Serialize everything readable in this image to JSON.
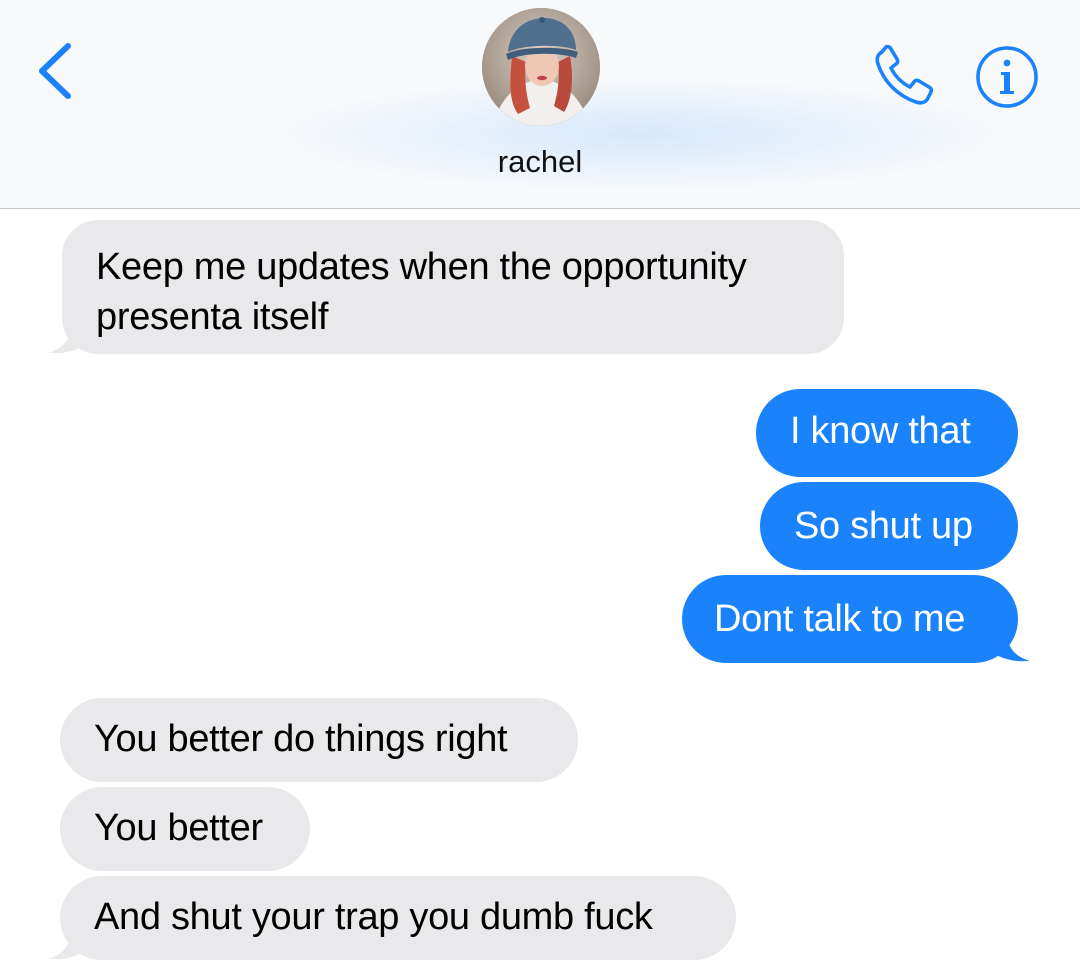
{
  "header": {
    "contact_name": "rachel",
    "back_icon": "chevron-left-icon",
    "call_icon": "phone-icon",
    "info_icon": "info-icon",
    "accent_color": "#1a82fb"
  },
  "messages": [
    {
      "direction": "incoming",
      "text_line1": "Keep me updates when the opportunity",
      "text_line2": "presenta itself"
    },
    {
      "direction": "outgoing",
      "text": "I know that"
    },
    {
      "direction": "outgoing",
      "text": "So shut up"
    },
    {
      "direction": "outgoing",
      "text": "Dont talk to me"
    },
    {
      "direction": "incoming",
      "text": "You better do things right"
    },
    {
      "direction": "incoming",
      "text": "You better"
    },
    {
      "direction": "incoming",
      "text": "And shut your trap you dumb fuck"
    }
  ],
  "colors": {
    "incoming_bubble": "#e9e9eb",
    "outgoing_bubble": "#1a82fb"
  }
}
